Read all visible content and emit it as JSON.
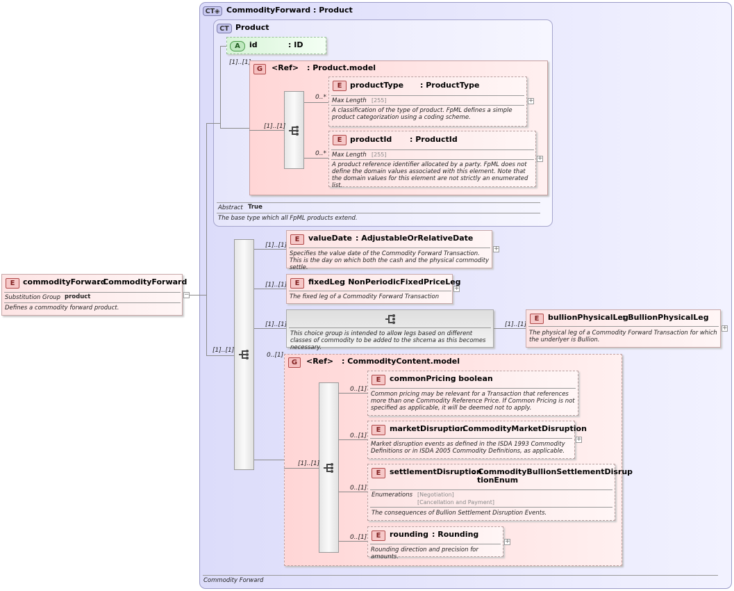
{
  "root_type": {
    "badge": "CT",
    "name": "CommodityForward",
    "base": ": Product",
    "footer": "Commodity Forward"
  },
  "product_type": {
    "badge": "CT",
    "name": "Product",
    "abstract_label": "Abstract",
    "abstract_value": "True",
    "doc": "The base type which all FpML products extend."
  },
  "attribute_id": {
    "badge": "A",
    "name": "id",
    "type": ": ID"
  },
  "product_model": {
    "badge": "G",
    "name": "<Ref>",
    "type": ": Product.model",
    "card": "[1]..[1]",
    "seq_card": "[1]..[1]"
  },
  "productType": {
    "badge": "E",
    "name": "productType",
    "type": ": ProductType",
    "card": "0..*",
    "facet_label": "Max Length",
    "facet_value": "[255]",
    "doc": "A classification of the type of product. FpML defines a simple product categorization using a coding scheme."
  },
  "productId": {
    "badge": "E",
    "name": "productId",
    "type": ": ProductId",
    "card": "0..*",
    "facet_label": "Max Length",
    "facet_value": "[255]",
    "doc": "A product reference identifier allocated by a party. FpML does not define the domain values associated with this element. Note that the domain values for this element are not strictly an enumerated list."
  },
  "commodityForward": {
    "badge": "E",
    "name": "commodityForward",
    "type": ": CommodityForward",
    "sub_label": "Substitution Group",
    "sub_value": "product",
    "doc": "Defines a commodity forward product."
  },
  "main_seq": {
    "card": "[1]..[1]"
  },
  "valueDate": {
    "badge": "E",
    "name": "valueDate",
    "type": ": AdjustableOrRelativeDate",
    "card": "[1]..[1]",
    "doc": "Specifies the value date of the Commodity Forward Transaction. This is the day on which both the cash and the physical commodity settle."
  },
  "fixedLeg": {
    "badge": "E",
    "name": "fixedLeg",
    "type": ": NonPeriodicFixedPriceLeg",
    "card": "[1]..[1]",
    "doc": "The fixed leg of a Commodity Forward Transaction"
  },
  "choice_group": {
    "card": "[1]..[1]",
    "doc": "This choice group is intended to allow legs based on different classes of commodity to be added to the shcema as this becomes necessary."
  },
  "bullionPhysicalLeg": {
    "badge": "E",
    "name": "bullionPhysicalLeg",
    "type": ": BullionPhysicalLeg",
    "card": "[1]..[1]",
    "doc": "The physical leg of a Commodity Forward Transaction for which the underlyer is Bullion."
  },
  "commodity_content": {
    "badge": "G",
    "name": "<Ref>",
    "type": ": CommodityContent.model",
    "card": "0..[1]",
    "seq_card": "[1]..[1]"
  },
  "commonPricing": {
    "badge": "E",
    "name": "commonPricing",
    "type": ": boolean",
    "card": "0..[1]",
    "doc": "Common pricing may be relevant for a Transaction that references more than one Commodity Reference Price. If Common Pricing is not specified as applicable, it will be deemed not to apply."
  },
  "marketDisruption": {
    "badge": "E",
    "name": "marketDisruption",
    "type": ": CommodityMarketDisruption",
    "card": "0..[1]",
    "doc": "Market disruption events as defined in the ISDA 1993 Commodity Definitions or in ISDA 2005 Commodity Definitions, as applicable."
  },
  "settlementDisruption": {
    "badge": "E",
    "name": "settlementDisruption",
    "type_line1": ": CommodityBullionSettlementDisrup",
    "type_line2": "tionEnum",
    "card": "0..[1]",
    "facet_label": "Enumerations",
    "enum1": "[Negotiation]",
    "enum2": "[Cancellation and Payment]",
    "doc": "The consequences of Bullion Settlement Disruption Events."
  },
  "rounding": {
    "badge": "E",
    "name": "rounding",
    "type": ": Rounding",
    "card": "0..[1]",
    "doc": "Rounding direction and precision for amounts."
  },
  "icons": {
    "sequence": "sequence-icon",
    "choice": "choice-icon",
    "expand": "expand-icon",
    "collapse": "collapse-icon"
  },
  "colors": {
    "complex_type": "#dcdcfa",
    "element": "#fde4e4",
    "group": "#ffd6d6",
    "attribute": "#bfe8bf"
  }
}
